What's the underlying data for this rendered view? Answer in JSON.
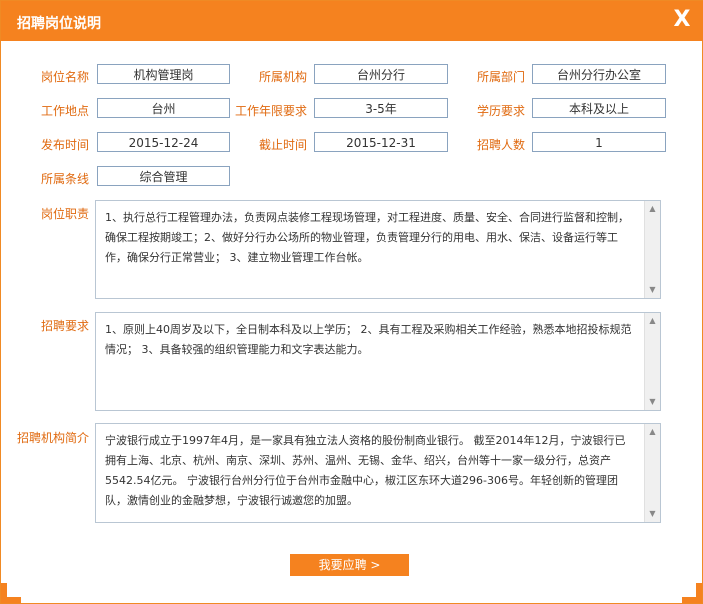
{
  "dialog": {
    "title": "招聘岗位说明",
    "close_label": "X"
  },
  "fields": {
    "post_name": {
      "label": "岗位名称",
      "value": "机构管理岗"
    },
    "org": {
      "label": "所属机构",
      "value": "台州分行"
    },
    "dept": {
      "label": "所属部门",
      "value": "台州分行办公室"
    },
    "location": {
      "label": "工作地点",
      "value": "台州"
    },
    "years": {
      "label": "工作年限要求",
      "value": "3-5年"
    },
    "education": {
      "label": "学历要求",
      "value": "本科及以上"
    },
    "publish": {
      "label": "发布时间",
      "value": "2015-12-24"
    },
    "deadline": {
      "label": "截止时间",
      "value": "2015-12-31"
    },
    "headcount": {
      "label": "招聘人数",
      "value": "1"
    },
    "line": {
      "label": "所属条线",
      "value": "综合管理"
    }
  },
  "duties": {
    "label": "岗位职责",
    "text": "1、执行总行工程管理办法，负责网点装修工程现场管理，对工程进度、质量、安全、合同进行监督和控制，确保工程按期竣工；2、做好分行办公场所的物业管理，负责管理分行的用电、用水、保洁、设备运行等工作，确保分行正常营业； 3、建立物业管理工作台帐。"
  },
  "requirements": {
    "label": "招聘要求",
    "text": "1、原则上40周岁及以下，全日制本科及以上学历；  2、具有工程及采购相关工作经验，熟悉本地招投标规范情况；  3、具备较强的组织管理能力和文字表达能力。"
  },
  "org_intro": {
    "label": "招聘机构简介",
    "text": "宁波银行成立于1997年4月，是一家具有独立法人资格的股份制商业银行。 截至2014年12月，宁波银行已拥有上海、北京、杭州、南京、深圳、苏州、温州、无锡、金华、绍兴，台州等十一家一级分行，总资产5542.54亿元。 宁波银行台州分行位于台州市金融中心，椒江区东环大道296-306号。年轻创新的管理团队，激情创业的金融梦想，宁波银行诚邀您的加盟。"
  },
  "apply_button": "我要应聘 >"
}
